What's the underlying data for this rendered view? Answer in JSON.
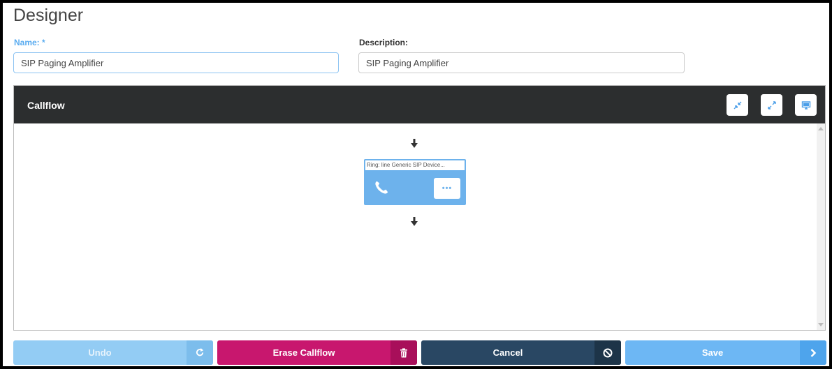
{
  "page": {
    "title": "Designer"
  },
  "form": {
    "name_label": "Name: *",
    "name_value": "SIP Paging Amplifier",
    "description_label": "Description:",
    "description_value": "SIP Paging Amplifier"
  },
  "callflow": {
    "title": "Callflow",
    "header_buttons": [
      {
        "icon": "collapse-icon"
      },
      {
        "icon": "expand-icon"
      },
      {
        "icon": "monitor-icon"
      }
    ],
    "node": {
      "label": "Ring: line Generic SIP Device...",
      "icon": "phone-icon",
      "more_label": "•••"
    }
  },
  "actions": {
    "undo_label": "Undo",
    "erase_label": "Erase Callflow",
    "cancel_label": "Cancel",
    "save_label": "Save"
  },
  "colors": {
    "header_bg": "#2c2e2f",
    "accent_blue": "#6db2ec",
    "erase": "#c8176e",
    "cancel": "#294763",
    "save": "#6db7f4",
    "undo_disabled": "#93ccf4"
  }
}
